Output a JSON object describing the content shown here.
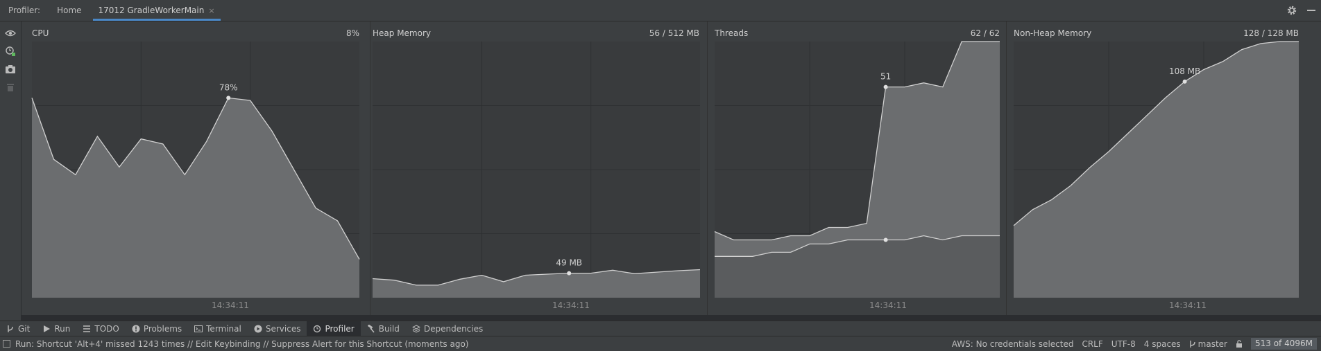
{
  "topbar": {
    "label": "Profiler:",
    "tabs": [
      {
        "label": "Home"
      },
      {
        "label": "17012 GradleWorkerMain"
      }
    ],
    "close_glyph": "×"
  },
  "panels": [
    {
      "title": "CPU",
      "value": "8%",
      "time": "14:34:11",
      "peak_label": "78%"
    },
    {
      "title": "Heap Memory",
      "value": "56 / 512 MB",
      "time": "14:34:11",
      "peak_label": "49 MB"
    },
    {
      "title": "Threads",
      "value": "62 / 62",
      "time": "14:34:11",
      "peak_label": "51"
    },
    {
      "title": "Non-Heap Memory",
      "value": "128 / 128 MB",
      "time": "14:34:11",
      "peak_label": "108 MB"
    }
  ],
  "chart_data": [
    {
      "type": "area",
      "title": "CPU",
      "unit": "%",
      "ylim": [
        0,
        100
      ],
      "values": [
        78,
        54,
        48,
        63,
        51,
        62,
        60,
        48,
        61,
        78,
        77,
        65,
        50,
        35,
        30,
        15
      ],
      "marker_index": 9,
      "marker_label": "78%"
    },
    {
      "type": "area",
      "title": "Heap Memory",
      "unit": "MB",
      "ylim": [
        0,
        512
      ],
      "values": [
        38,
        35,
        25,
        25,
        37,
        45,
        32,
        45,
        47,
        49,
        49,
        55,
        48,
        51,
        54,
        56
      ],
      "marker_index": 9,
      "marker_label": "49 MB"
    },
    {
      "type": "area",
      "title": "Threads",
      "ylim": [
        0,
        62
      ],
      "series": [
        {
          "values": [
            16,
            14,
            14,
            14,
            15,
            15,
            17,
            17,
            18,
            51,
            51,
            52,
            51,
            62,
            62,
            62
          ]
        },
        {
          "values": [
            10,
            10,
            10,
            11,
            11,
            13,
            13,
            14,
            14,
            14,
            14,
            15,
            14,
            15,
            15,
            15
          ]
        }
      ],
      "marker_index": 9,
      "marker_label": "51"
    },
    {
      "type": "area",
      "title": "Non-Heap Memory",
      "unit": "MB",
      "ylim": [
        0,
        128
      ],
      "values": [
        36,
        44,
        49,
        56,
        65,
        73,
        82,
        91,
        100,
        108,
        114,
        118,
        124,
        127,
        128,
        128
      ],
      "marker_index": 9,
      "marker_label": "108 MB"
    }
  ],
  "tool_windows": [
    {
      "label": "Git",
      "icon": "git-branch-icon"
    },
    {
      "label": "Run",
      "icon": "run-icon"
    },
    {
      "label": "TODO",
      "icon": "todo-list-icon"
    },
    {
      "label": "Problems",
      "icon": "problems-icon"
    },
    {
      "label": "Terminal",
      "icon": "terminal-icon"
    },
    {
      "label": "Services",
      "icon": "services-icon"
    },
    {
      "label": "Profiler",
      "icon": "profiler-icon",
      "active": true
    },
    {
      "label": "Build",
      "icon": "build-hammer-icon"
    },
    {
      "label": "Dependencies",
      "icon": "dependencies-icon"
    }
  ],
  "status": {
    "message": "Run: Shortcut 'Alt+4' missed 1243 times // Edit Keybinding // Suppress Alert for this Shortcut (moments ago)",
    "aws": "AWS: No credentials selected",
    "line_sep": "CRLF",
    "encoding": "UTF-8",
    "indent": "4 spaces",
    "branch": "master",
    "memory": "513 of 4096M"
  },
  "colors": {
    "area_fill": "#6b6d6f",
    "area_fill2": "#5a5c5e",
    "line": "#d0d0d0",
    "grid": "#2f3133",
    "accent": "#4a88c7"
  }
}
